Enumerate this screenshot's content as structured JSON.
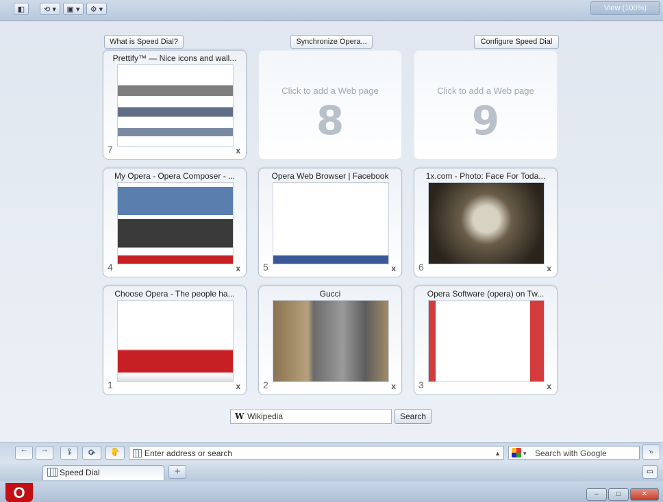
{
  "window": {
    "logo": "O",
    "minimize": "‒",
    "maximize": "□",
    "close": "✕"
  },
  "tabs": [
    {
      "label": "Speed Dial",
      "icon": "speed-dial-grid-icon"
    }
  ],
  "new_tab_label": "+",
  "panel_toggle_icon": "panel-icon",
  "address_bar": {
    "back": "←",
    "forward": "→",
    "key_icon": "⚷",
    "reload": "⟳",
    "wand_icon": "✋",
    "placeholder": "Enter address or search",
    "dropdown": "▲",
    "search_placeholder": "Search with Google",
    "search_dropdown": "▾",
    "search_go": "⌕"
  },
  "speed_dial": {
    "search_engine": "Wikipedia",
    "search_engine_icon": "W",
    "search_button": "Search",
    "dials": [
      {
        "number": "1",
        "title": "Choose Opera - The people ha...",
        "close": "x"
      },
      {
        "number": "2",
        "title": "Gucci",
        "close": "x"
      },
      {
        "number": "3",
        "title": "Opera Software (opera) on Tw...",
        "close": "x"
      },
      {
        "number": "4",
        "title": "My Opera - Opera Composer - ...",
        "close": "x"
      },
      {
        "number": "5",
        "title": "Opera Web Browser | Facebook",
        "close": "x"
      },
      {
        "number": "6",
        "title": "1x.com - Photo: Face For Toda...",
        "close": "x"
      },
      {
        "number": "7",
        "title": "Prettify™ — Nice icons and wall...",
        "close": "x"
      }
    ],
    "empty_dials": [
      {
        "number": "8",
        "hint": "Click to add a Web page"
      },
      {
        "number": "9",
        "hint": "Click to add a Web page"
      }
    ],
    "buttons": {
      "what_is": "What is Speed Dial?",
      "synchronize": "Synchronize Opera...",
      "configure": "Configure Speed Dial"
    }
  },
  "bottom_bar": {
    "panel_btn": "◧",
    "sync_btn": "⟲ ▾",
    "unite_btn": "▣ ▾",
    "settings_btn": "⚙ ▾",
    "view_label": "View (100%)"
  }
}
